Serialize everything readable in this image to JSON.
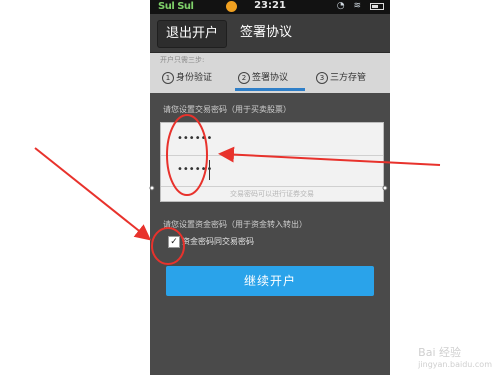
{
  "status_bar": {
    "signal": "Sul Sul",
    "clock": "23:21"
  },
  "nav": {
    "tab_active": "退出开户",
    "tab_inactive": "签署协议"
  },
  "steps": {
    "caption": "开户只需三步:",
    "items": [
      {
        "num": "1",
        "label": "身份验证"
      },
      {
        "num": "2",
        "label": "签署协议"
      },
      {
        "num": "3",
        "label": "三方存管"
      }
    ]
  },
  "form": {
    "trade_password_title": "请您设置交易密码（用于买卖股票）",
    "password_value": "••••••",
    "confirm_value": "••••••",
    "trade_password_hint": "交易密码可以进行证券交易",
    "fund_password_title": "请您设置资金密码（用于资金转入转出）",
    "same_as_trade_label": "资金密码同交易密码",
    "same_as_trade_checked": true,
    "checkmark": "✓",
    "continue_label": "继续开户"
  },
  "watermark": {
    "text": "Bai 经验",
    "url": "jingyan.baidu.com"
  },
  "colors": {
    "accent_button": "#2aa3ea",
    "annotation_red": "#e8322c",
    "step_underline": "#2f7fc8"
  }
}
